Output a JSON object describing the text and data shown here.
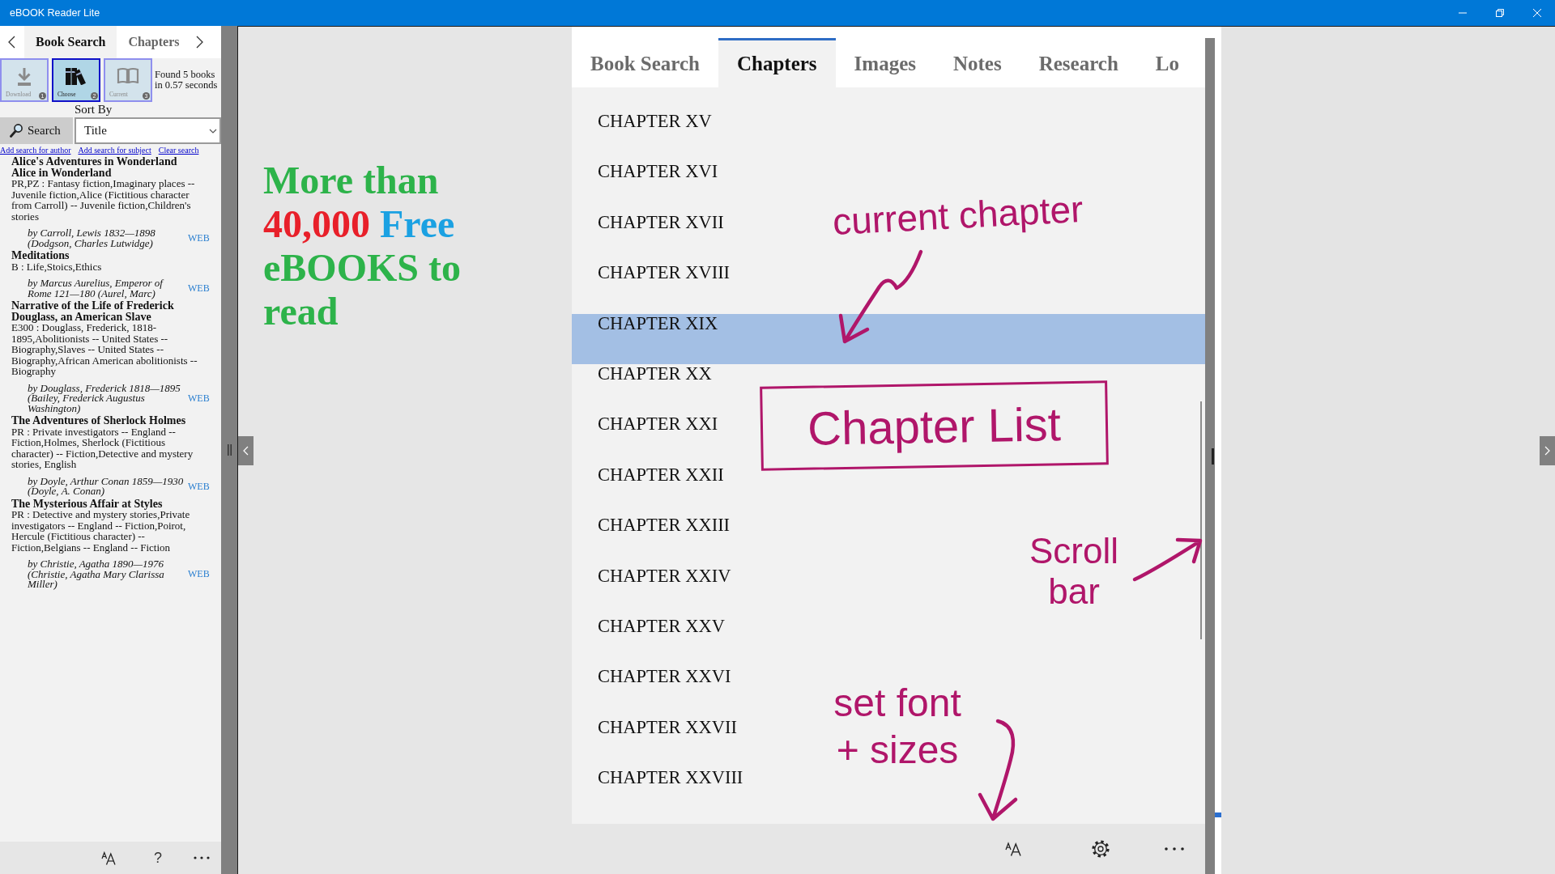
{
  "window": {
    "title": "eBOOK Reader Lite"
  },
  "left_panel": {
    "tabs": [
      {
        "label": "Book Search",
        "selected": true
      },
      {
        "label": "Chapters",
        "selected": false
      }
    ],
    "mode_buttons": [
      {
        "kind": "download",
        "label": "Download",
        "number": "1",
        "selected": false
      },
      {
        "kind": "choose",
        "label": "Choose",
        "number": "2",
        "selected": true
      },
      {
        "kind": "current",
        "label": "Current",
        "number": "3",
        "selected": false
      }
    ],
    "result_summary": "Found 5 books in 0.57 seconds",
    "sort_label": "Sort By",
    "search_button": "Search",
    "sort_field": {
      "value": "Title"
    },
    "links": [
      "Add search for author",
      "Add search for subject",
      "Clear search"
    ],
    "books": [
      {
        "title": "Alice's Adventures in Wonderland",
        "alternate_title": "Alice in Wonderland",
        "subjects": "PR,PZ : Fantasy fiction,Imaginary places -- Juvenile fiction,Alice (Fictitious character from Carroll) -- Juvenile fiction,Children's stories",
        "author": "by Carroll, Lewis 1832—1898 (Dodgson, Charles Lutwidge)",
        "link": "WEB"
      },
      {
        "title": "Meditations",
        "subjects": "B : Life,Stoics,Ethics",
        "author": "by Marcus Aurelius, Emperor of Rome 121—180 (Aurel, Marc)",
        "link": "WEB"
      },
      {
        "title": "Narrative of the Life of Frederick Douglass, an American Slave",
        "subjects": "E300 : Douglass, Frederick, 1818-1895,Abolitionists -- United States -- Biography,Slaves -- United States -- Biography,African American abolitionists -- Biography",
        "author": "by Douglass, Frederick 1818—1895 (Bailey, Frederick Augustus Washington)",
        "link": "WEB"
      },
      {
        "title": "The Adventures of Sherlock Holmes",
        "subjects": "PR : Private investigators -- England -- Fiction,Holmes, Sherlock (Fictitious character) -- Fiction,Detective and mystery stories, English",
        "author": "by Doyle, Arthur Conan 1859—1930 (Doyle, A. Conan)",
        "link": "WEB"
      },
      {
        "title": "The Mysterious Affair at Styles",
        "subjects": "PR : Detective and mystery stories,Private investigators -- England -- Fiction,Poirot, Hercule (Fictitious character) -- Fiction,Belgians -- England -- Fiction",
        "author": "by Christie, Agatha 1890—1976 (Christie, Agatha Mary Clarissa Miller)",
        "link": "WEB"
      }
    ],
    "bottom_bar": {
      "help": "?"
    }
  },
  "promo": [
    {
      "text": "More than",
      "color": "#2db34a"
    },
    {
      "text": "40,000",
      "color": "#e8202a"
    },
    {
      "text": "Free",
      "color": "#1ba1e2"
    },
    {
      "text": "eBOOKS to read",
      "color": "#2db34a"
    }
  ],
  "reader": {
    "tabs": [
      {
        "label": "Book Search",
        "selected": false
      },
      {
        "label": "Chapters",
        "selected": true
      },
      {
        "label": "Images",
        "selected": false
      },
      {
        "label": "Notes",
        "selected": false
      },
      {
        "label": "Research",
        "selected": false
      },
      {
        "label": "Lo",
        "selected": false
      }
    ],
    "chapters": [
      {
        "label": "CHAPTER XV",
        "selected": false
      },
      {
        "label": "CHAPTER XVI",
        "selected": false
      },
      {
        "label": "CHAPTER XVII",
        "selected": false
      },
      {
        "label": "CHAPTER XVIII",
        "selected": false
      },
      {
        "label": "CHAPTER XIX",
        "selected": true
      },
      {
        "label": "CHAPTER XX",
        "selected": false
      },
      {
        "label": "CHAPTER XXI",
        "selected": false
      },
      {
        "label": "CHAPTER XXII",
        "selected": false
      },
      {
        "label": "CHAPTER XXIII",
        "selected": false
      },
      {
        "label": "CHAPTER XXIV",
        "selected": false
      },
      {
        "label": "CHAPTER XXV",
        "selected": false
      },
      {
        "label": "CHAPTER XXVI",
        "selected": false
      },
      {
        "label": "CHAPTER XXVII",
        "selected": false
      },
      {
        "label": "CHAPTER XXVIII",
        "selected": false
      }
    ],
    "annotations": [
      {
        "kind": "note",
        "text": "current chapter"
      },
      {
        "kind": "boxed",
        "text": "Chapter List"
      },
      {
        "kind": "note",
        "text": "Scroll bar"
      },
      {
        "kind": "note",
        "text": "set font + sizes"
      }
    ]
  }
}
